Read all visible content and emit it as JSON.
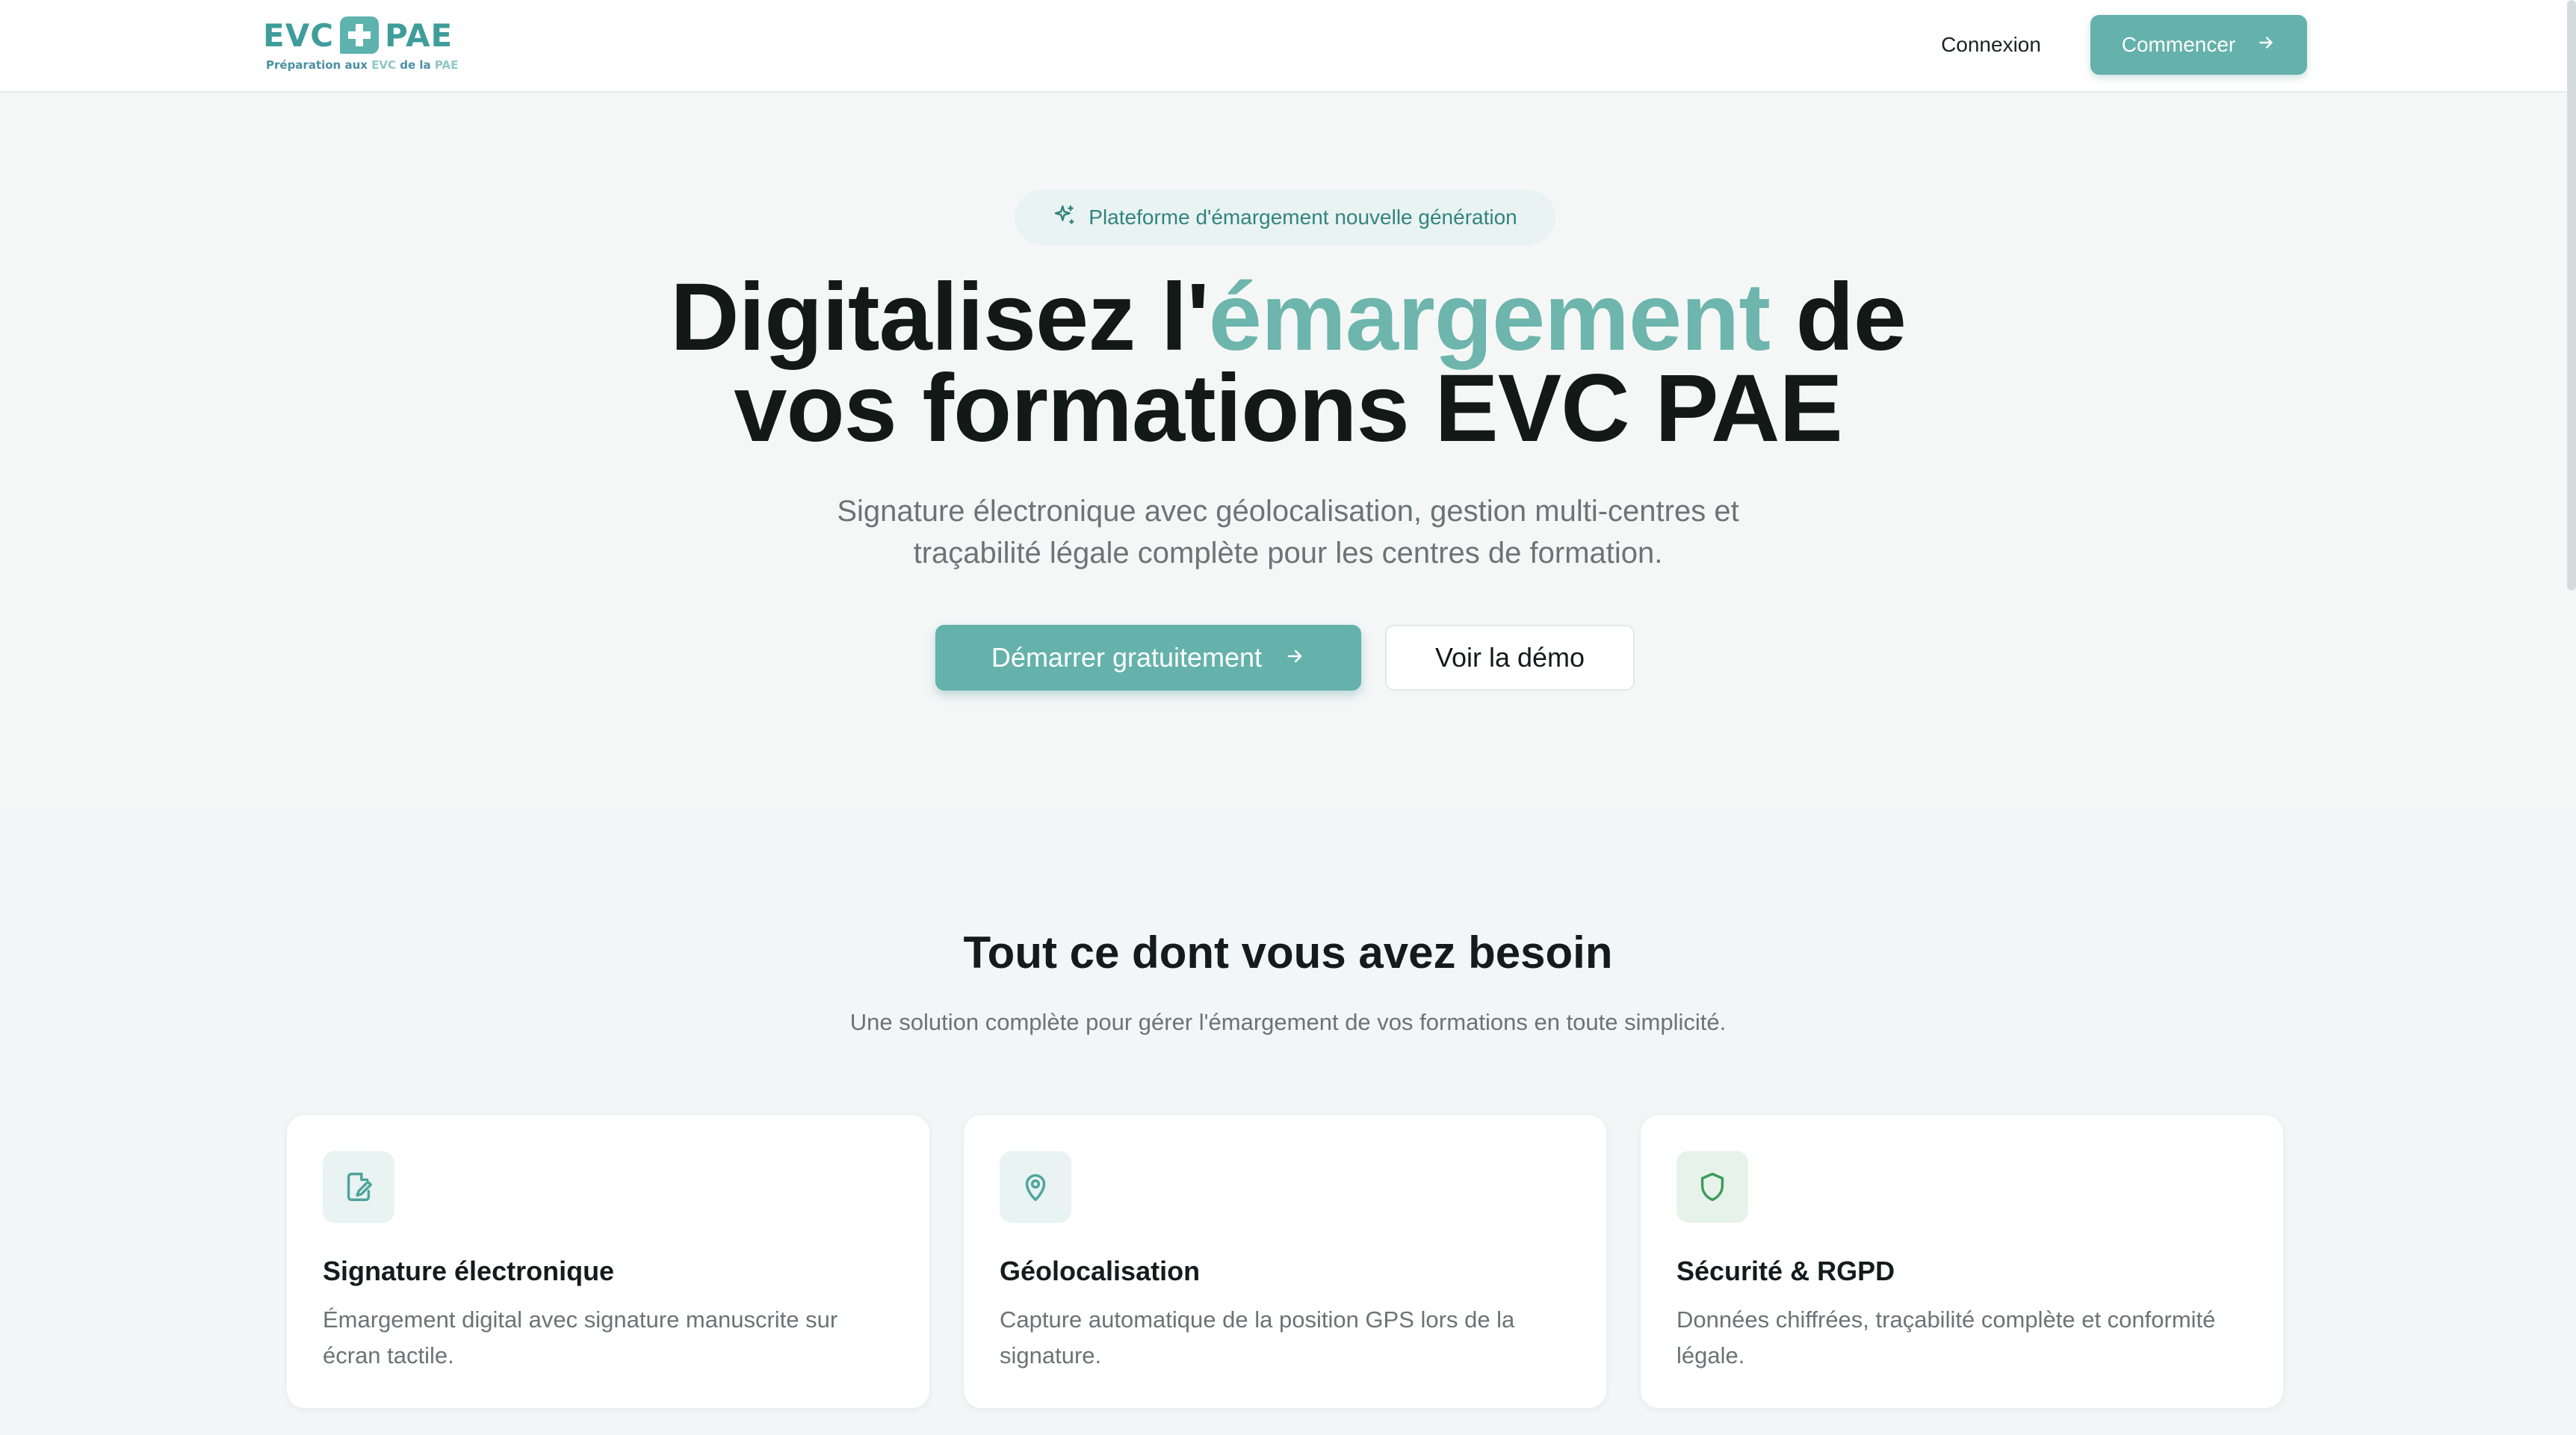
{
  "brand": {
    "logo_left": "EVC",
    "logo_right": "PAE",
    "tagline_prefix": "Préparation aux",
    "tagline_evc": "EVC",
    "tagline_mid": "de la",
    "tagline_pae": "PAE",
    "primary_color": "#64b2ab",
    "accent_color": "#6db5ad"
  },
  "nav": {
    "login_label": "Connexion",
    "cta_label": "Commencer",
    "cta_icon": "arrow-right-icon"
  },
  "hero": {
    "badge_icon": "sparkles-icon",
    "badge_text": "Plateforme d'émargement nouvelle génération",
    "title_part1": "Digitalisez l'",
    "title_accent": "émargement",
    "title_part2": " de",
    "title_line2": "vos formations EVC PAE",
    "subtitle_line1": "Signature électronique avec géolocalisation, gestion multi-centres et",
    "subtitle_line2": "traçabilité légale complète pour les centres de formation.",
    "primary_button": "Démarrer gratuitement",
    "secondary_button": "Voir la démo"
  },
  "features": {
    "title": "Tout ce dont vous avez besoin",
    "subtitle": "Une solution complète pour gérer l'émargement de vos formations en toute simplicité.",
    "items": [
      {
        "icon": "signature-edit-icon",
        "title": "Signature électronique",
        "description": "Émargement digital avec signature manuscrite sur écran tactile."
      },
      {
        "icon": "map-pin-icon",
        "title": "Géolocalisation",
        "description": "Capture automatique de la position GPS lors de la signature."
      },
      {
        "icon": "shield-icon",
        "title": "Sécurité & RGPD",
        "description": "Données chiffrées, traçabilité complète et conformité légale."
      }
    ]
  }
}
